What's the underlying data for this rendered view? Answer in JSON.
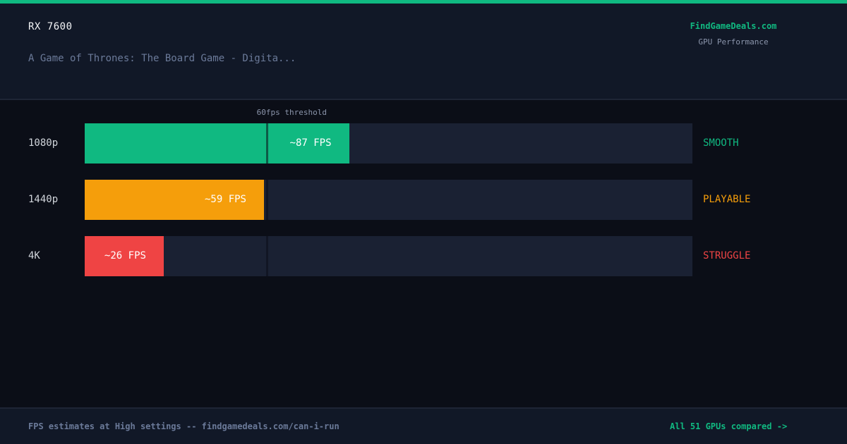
{
  "header": {
    "gpu_name": "RX 7600",
    "game_title": "A Game of Thrones: The Board Game - Digita...",
    "brand": "FindGameDeals.com",
    "brand_sub": "GPU Performance"
  },
  "chart_data": {
    "type": "bar",
    "orientation": "horizontal",
    "categories": [
      "1080p",
      "1440p",
      "4K"
    ],
    "values": [
      87,
      59,
      26
    ],
    "value_labels": [
      "~87 FPS",
      "~59 FPS",
      "~26 FPS"
    ],
    "status_labels": [
      "SMOOTH",
      "PLAYABLE",
      "STRUGGLE"
    ],
    "colors": [
      "#10b981",
      "#f59e0b",
      "#ef4444"
    ],
    "xlim": [
      0,
      200
    ],
    "threshold": {
      "value": 60,
      "label": "60fps threshold"
    }
  },
  "footer": {
    "left_text": "FPS estimates at High settings -- findgamedeals.com/can-i-run",
    "right_link": "All 51 GPUs compared ->"
  }
}
